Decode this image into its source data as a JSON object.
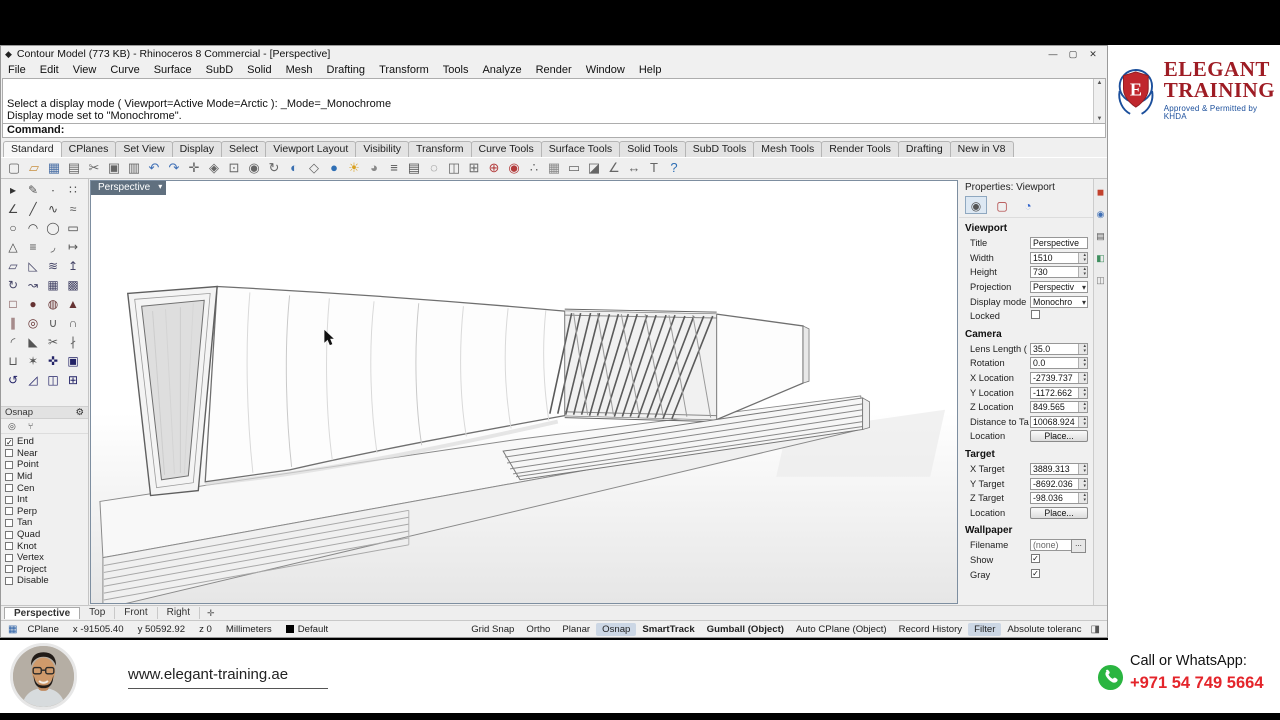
{
  "window": {
    "title": "Contour Model (773 KB) - Rhinoceros 8 Commercial - [Perspective]",
    "minimize": "—",
    "maximize": "▢",
    "close": "✕"
  },
  "menu": {
    "items": [
      {
        "label": "File"
      },
      {
        "label": "Edit"
      },
      {
        "label": "View"
      },
      {
        "label": "Curve"
      },
      {
        "label": "Surface"
      },
      {
        "label": "SubD"
      },
      {
        "label": "Solid"
      },
      {
        "label": "Mesh"
      },
      {
        "label": "Drafting"
      },
      {
        "label": "Transform"
      },
      {
        "label": "Tools"
      },
      {
        "label": "Analyze"
      },
      {
        "label": "Render"
      },
      {
        "label": "Window"
      },
      {
        "label": "Help"
      }
    ]
  },
  "command": {
    "history": [
      "Select a display mode ( Viewport=Active  Mode=Arctic ): _Mode=_Monochrome",
      "Display mode set to \"Monochrome\"."
    ],
    "prompt": "Command:"
  },
  "toolbar_tabs": {
    "items": [
      {
        "label": "Standard",
        "cls": "active"
      },
      {
        "label": "CPlanes"
      },
      {
        "label": "Set View"
      },
      {
        "label": "Display"
      },
      {
        "label": "Select"
      },
      {
        "label": "Viewport Layout"
      },
      {
        "label": "Visibility"
      },
      {
        "label": "Transform"
      },
      {
        "label": "Curve Tools"
      },
      {
        "label": "Surface Tools"
      },
      {
        "label": "Solid Tools"
      },
      {
        "label": "SubD Tools"
      },
      {
        "label": "Mesh Tools"
      },
      {
        "label": "Render Tools"
      },
      {
        "label": "Drafting"
      },
      {
        "label": "New in V8"
      }
    ]
  },
  "main_toolbar": {
    "icons": [
      {
        "name": "new-file-icon",
        "glyph": "▢",
        "color": "#666"
      },
      {
        "name": "open-file-icon",
        "glyph": "▱",
        "color": "#c89040"
      },
      {
        "name": "save-file-icon",
        "glyph": "▦",
        "color": "#4a6fa5"
      },
      {
        "name": "print-icon",
        "glyph": "▤",
        "color": "#666"
      },
      {
        "name": "cut-icon",
        "glyph": "✂",
        "color": "#666"
      },
      {
        "name": "copy-icon",
        "glyph": "▣",
        "color": "#666"
      },
      {
        "name": "paste-icon",
        "glyph": "▥",
        "color": "#666"
      },
      {
        "name": "undo-icon",
        "glyph": "↶",
        "color": "#3f6fb5"
      },
      {
        "name": "redo-icon",
        "glyph": "↷",
        "color": "#3f6fb5"
      },
      {
        "name": "pan-icon",
        "glyph": "✛",
        "color": "#666"
      },
      {
        "name": "zoom-extents-icon",
        "glyph": "◈",
        "color": "#666"
      },
      {
        "name": "zoom-window-icon",
        "glyph": "⊡",
        "color": "#666"
      },
      {
        "name": "zoom-selected-icon",
        "glyph": "◉",
        "color": "#666"
      },
      {
        "name": "rotate-view-icon",
        "glyph": "↻",
        "color": "#666"
      },
      {
        "name": "shaded-view-icon",
        "glyph": "◐",
        "color": "#3a6fb0"
      },
      {
        "name": "wireframe-view-icon",
        "glyph": "◇",
        "color": "#666"
      },
      {
        "name": "render-icon",
        "glyph": "●",
        "color": "#2f6fb5"
      },
      {
        "name": "lights-icon",
        "glyph": "☀",
        "color": "#d9a020"
      },
      {
        "name": "materials-icon",
        "glyph": "◕",
        "color": "#888"
      },
      {
        "name": "layers-icon",
        "glyph": "≡",
        "color": "#555"
      },
      {
        "name": "object-properties-icon",
        "glyph": "▤",
        "color": "#555"
      },
      {
        "name": "hide-object-icon",
        "glyph": "◌",
        "color": "#666"
      },
      {
        "name": "lock-object-icon",
        "glyph": "◫",
        "color": "#666"
      },
      {
        "name": "group-icon",
        "glyph": "⊞",
        "color": "#666"
      },
      {
        "name": "gumball-icon",
        "glyph": "⊕",
        "color": "#b33c3c"
      },
      {
        "name": "record-history-icon",
        "glyph": "◉",
        "color": "#b33c3c"
      },
      {
        "name": "osnap-settings-icon",
        "glyph": "∴",
        "color": "#666"
      },
      {
        "name": "grid-icon",
        "glyph": "▦",
        "color": "#888"
      },
      {
        "name": "named-views-icon",
        "glyph": "▭",
        "color": "#666"
      },
      {
        "name": "clipping-plane-icon",
        "glyph": "◪",
        "color": "#666"
      },
      {
        "name": "analyze-icon",
        "glyph": "∠",
        "color": "#666"
      },
      {
        "name": "dimension-icon",
        "glyph": "↔",
        "color": "#666"
      },
      {
        "name": "text-icon",
        "glyph": "T",
        "color": "#666"
      },
      {
        "name": "help-icon",
        "glyph": "?",
        "color": "#2f6fb5"
      }
    ]
  },
  "left_toolbar": {
    "icons": [
      {
        "name": "select-arrow-icon",
        "glyph": "▸",
        "color": "#333"
      },
      {
        "name": "lasso-select-icon",
        "glyph": "✎",
        "color": "#555"
      },
      {
        "name": "point-icon",
        "glyph": "∙",
        "color": "#333"
      },
      {
        "name": "point-cloud-icon",
        "glyph": "∷",
        "color": "#555"
      },
      {
        "name": "polyline-icon",
        "glyph": "∠",
        "color": "#444"
      },
      {
        "name": "line-icon",
        "glyph": "╱",
        "color": "#444"
      },
      {
        "name": "curve-icon",
        "glyph": "∿",
        "color": "#444"
      },
      {
        "name": "handle-curve-icon",
        "glyph": "≈",
        "color": "#555"
      },
      {
        "name": "circle-icon",
        "glyph": "○",
        "color": "#444"
      },
      {
        "name": "arc-icon",
        "glyph": "◠",
        "color": "#444"
      },
      {
        "name": "ellipse-icon",
        "glyph": "◯",
        "color": "#555"
      },
      {
        "name": "rectangle-icon",
        "glyph": "▭",
        "color": "#444"
      },
      {
        "name": "polygon-icon",
        "glyph": "△",
        "color": "#444"
      },
      {
        "name": "offset-curve-icon",
        "glyph": "≡",
        "color": "#555"
      },
      {
        "name": "fillet-curve-icon",
        "glyph": "◞",
        "color": "#555"
      },
      {
        "name": "extend-curve-icon",
        "glyph": "↦",
        "color": "#555"
      },
      {
        "name": "surface-plane-icon",
        "glyph": "▱",
        "color": "#446"
      },
      {
        "name": "surface-corner-icon",
        "glyph": "◺",
        "color": "#446"
      },
      {
        "name": "loft-icon",
        "glyph": "≋",
        "color": "#446"
      },
      {
        "name": "extrude-icon",
        "glyph": "↥",
        "color": "#446"
      },
      {
        "name": "revolve-icon",
        "glyph": "↻",
        "color": "#446"
      },
      {
        "name": "sweep-icon",
        "glyph": "↝",
        "color": "#446"
      },
      {
        "name": "patch-icon",
        "glyph": "▦",
        "color": "#446"
      },
      {
        "name": "network-surface-icon",
        "glyph": "▩",
        "color": "#446"
      },
      {
        "name": "box-icon",
        "glyph": "□",
        "color": "#633"
      },
      {
        "name": "sphere-icon",
        "glyph": "●",
        "color": "#633"
      },
      {
        "name": "cylinder-icon",
        "glyph": "◍",
        "color": "#633"
      },
      {
        "name": "cone-icon",
        "glyph": "▲",
        "color": "#633"
      },
      {
        "name": "pipe-icon",
        "glyph": "∥",
        "color": "#633"
      },
      {
        "name": "torus-icon",
        "glyph": "◎",
        "color": "#633"
      },
      {
        "name": "boolean-union-icon",
        "glyph": "∪",
        "color": "#555"
      },
      {
        "name": "boolean-difference-icon",
        "glyph": "∩",
        "color": "#555"
      },
      {
        "name": "fillet-edge-icon",
        "glyph": "◜",
        "color": "#555"
      },
      {
        "name": "chamfer-edge-icon",
        "glyph": "◣",
        "color": "#555"
      },
      {
        "name": "trim-icon",
        "glyph": "✂",
        "color": "#555"
      },
      {
        "name": "split-icon",
        "glyph": "∤",
        "color": "#555"
      },
      {
        "name": "join-icon",
        "glyph": "⊔",
        "color": "#555"
      },
      {
        "name": "explode-icon",
        "glyph": "✶",
        "color": "#555"
      },
      {
        "name": "move-icon",
        "glyph": "✜",
        "color": "#226"
      },
      {
        "name": "copy-object-icon",
        "glyph": "▣",
        "color": "#226"
      },
      {
        "name": "rotate-icon",
        "glyph": "↺",
        "color": "#226"
      },
      {
        "name": "scale-icon",
        "glyph": "◿",
        "color": "#226"
      },
      {
        "name": "mirror-icon",
        "glyph": "◫",
        "color": "#226"
      },
      {
        "name": "array-icon",
        "glyph": "⊞",
        "color": "#226"
      }
    ]
  },
  "osnap": {
    "title": "Osnap",
    "items": [
      {
        "label": "End",
        "cls": "checked"
      },
      {
        "label": "Near"
      },
      {
        "label": "Point"
      },
      {
        "label": "Mid"
      },
      {
        "label": "Cen"
      },
      {
        "label": "Int"
      },
      {
        "label": "Perp"
      },
      {
        "label": "Tan"
      },
      {
        "label": "Quad"
      },
      {
        "label": "Knot"
      },
      {
        "label": "Vertex"
      },
      {
        "label": "Project"
      },
      {
        "label": "Disable"
      }
    ]
  },
  "viewport": {
    "label": "Perspective",
    "new_tab_glyph": "✛",
    "tabs": [
      {
        "label": "Perspective",
        "cls": "active"
      },
      {
        "label": "Top"
      },
      {
        "label": "Front"
      },
      {
        "label": "Right"
      }
    ]
  },
  "props": {
    "header": "Properties: Viewport",
    "icons": [
      {
        "name": "viewport-properties-icon",
        "glyph": "◉",
        "color": "#555",
        "cls": "active"
      },
      {
        "name": "display-properties-icon",
        "glyph": "▢",
        "color": "#a33",
        "cls": ""
      },
      {
        "name": "object-display-icon",
        "glyph": "◔",
        "color": "#36c",
        "cls": ""
      }
    ],
    "viewport_section": {
      "title": "Viewport",
      "rows": [
        {
          "label": "Title",
          "value": "Perspective",
          "type": "text"
        },
        {
          "label": "Width",
          "value": "1510",
          "type": "num"
        },
        {
          "label": "Height",
          "value": "730",
          "type": "num"
        },
        {
          "label": "Projection",
          "value": "Perspectiv",
          "type": "select"
        },
        {
          "label": "Display mode",
          "value": "Monochro",
          "type": "select"
        },
        {
          "label": "Locked",
          "value": "",
          "type": "check"
        }
      ]
    },
    "camera_section": {
      "title": "Camera",
      "rows": [
        {
          "label": "Lens Length (",
          "value": "35.0",
          "type": "num"
        },
        {
          "label": "Rotation",
          "value": "0.0",
          "type": "num"
        },
        {
          "label": "X Location",
          "value": "-2739.737",
          "type": "num"
        },
        {
          "label": "Y Location",
          "value": "-1172.662",
          "type": "num"
        },
        {
          "label": "Z Location",
          "value": "849.565",
          "type": "num"
        },
        {
          "label": "Distance to Ta",
          "value": "10068.924",
          "type": "num"
        },
        {
          "label": "Location",
          "value": "Place...",
          "type": "button"
        }
      ]
    },
    "target_section": {
      "title": "Target",
      "rows": [
        {
          "label": "X Target",
          "value": "3889.313",
          "type": "num"
        },
        {
          "label": "Y Target",
          "value": "-8692.036",
          "type": "num"
        },
        {
          "label": "Z Target",
          "value": "-98.036",
          "type": "num"
        },
        {
          "label": "Location",
          "value": "Place...",
          "type": "button"
        }
      ]
    },
    "wallpaper_section": {
      "title": "Wallpaper",
      "rows": [
        {
          "label": "Filename",
          "value": "(none)",
          "type": "filename"
        },
        {
          "label": "Show",
          "value": "✓",
          "type": "check"
        },
        {
          "label": "Gray",
          "value": "✓",
          "type": "check"
        }
      ]
    }
  },
  "side_tabs": {
    "items": [
      {
        "name": "properties-panel-tab-icon",
        "glyph": "◼",
        "color": "#c2412d"
      },
      {
        "name": "layers-panel-tab-icon",
        "glyph": "◉",
        "color": "#3f6fb5"
      },
      {
        "name": "display-panel-tab-icon",
        "glyph": "▤",
        "color": "#555"
      },
      {
        "name": "help-panel-tab-icon",
        "glyph": "◧",
        "color": "#3f8f5f"
      },
      {
        "name": "libraries-panel-tab-icon",
        "glyph": "◫",
        "color": "#777"
      }
    ]
  },
  "statusbar": {
    "grid_glyph": "▦",
    "panel_glyph": "◨",
    "left": [
      {
        "label": "CPlane"
      },
      {
        "label": "x -91505.40"
      },
      {
        "label": "y 50592.92"
      },
      {
        "label": "z 0"
      },
      {
        "label": "Millimeters"
      },
      {
        "label": "Default",
        "cls": "swatch"
      }
    ],
    "toggles": [
      {
        "label": "Grid Snap"
      },
      {
        "label": "Ortho"
      },
      {
        "label": "Planar"
      },
      {
        "label": "Osnap",
        "cls": "hl"
      },
      {
        "label": "SmartTrack",
        "cls": "bold"
      },
      {
        "label": "Gumball (Object)",
        "cls": "bold"
      },
      {
        "label": "Auto CPlane (Object)"
      },
      {
        "label": "Record History"
      },
      {
        "label": "Filter",
        "cls": "hl"
      },
      {
        "label": "Absolute toleranc"
      }
    ]
  },
  "branding": {
    "line1": "ELEGANT",
    "line2": "TRAINING",
    "approval": "Approved & Permitted by KHDA",
    "website": "www.elegant-training.ae",
    "call_label": "Call or WhatsApp:",
    "phone": "+971 54 749 5664",
    "brand_red": "#9e1c24",
    "brand_red_bright": "#e4252b",
    "brand_blue": "#1b4f9c",
    "whatsapp_green": "#2ab540"
  }
}
